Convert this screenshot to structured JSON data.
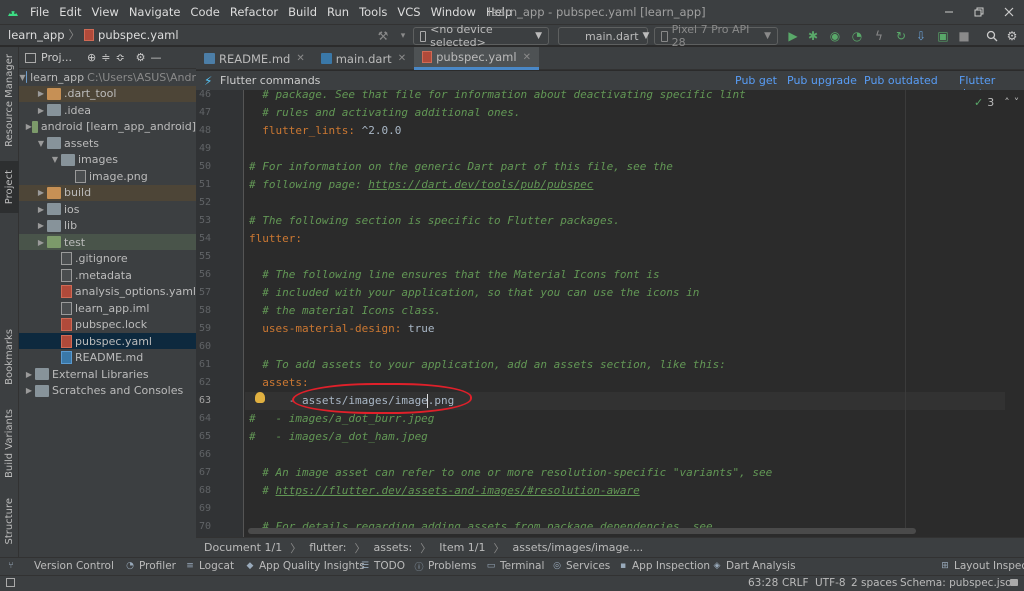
{
  "menu": [
    "File",
    "Edit",
    "View",
    "Navigate",
    "Code",
    "Refactor",
    "Build",
    "Run",
    "Tools",
    "VCS",
    "Window",
    "Help"
  ],
  "window_title": "learn_app - pubspec.yaml [learn_app]",
  "breadcrumb": {
    "project": "learn_app",
    "file": "pubspec.yaml"
  },
  "toolbar": {
    "device_combo": "<no device selected>",
    "run_config": "main.dart",
    "emulator": "Pixel 7 Pro API 28"
  },
  "side_tabs": {
    "resource_manager": "Resource Manager",
    "project": "Project",
    "bookmarks": "Bookmarks",
    "build_variants": "Build Variants",
    "structure": "Structure"
  },
  "project_panel": {
    "title": "Proj...",
    "tree": [
      {
        "label": "learn_app",
        "hint": "C:\\Users\\ASUS\\Andr",
        "kind": "root"
      },
      {
        "label": ".dart_tool",
        "kind": "folder-excluded"
      },
      {
        "label": ".idea",
        "kind": "folder"
      },
      {
        "label": "android [learn_app_android]",
        "kind": "folder"
      },
      {
        "label": "assets",
        "kind": "folder"
      },
      {
        "label": "images",
        "kind": "folder"
      },
      {
        "label": "image.png",
        "kind": "file"
      },
      {
        "label": "build",
        "kind": "folder-excluded"
      },
      {
        "label": "ios",
        "kind": "folder"
      },
      {
        "label": "lib",
        "kind": "folder"
      },
      {
        "label": "test",
        "kind": "folder-test"
      },
      {
        "label": ".gitignore",
        "kind": "file"
      },
      {
        "label": ".metadata",
        "kind": "file"
      },
      {
        "label": "analysis_options.yaml",
        "kind": "yaml"
      },
      {
        "label": "learn_app.iml",
        "kind": "file"
      },
      {
        "label": "pubspec.lock",
        "kind": "yaml"
      },
      {
        "label": "pubspec.yaml",
        "kind": "yaml-selected"
      },
      {
        "label": "README.md",
        "kind": "file"
      },
      {
        "label": "External Libraries",
        "kind": "lib"
      },
      {
        "label": "Scratches and Consoles",
        "kind": "scratch"
      }
    ]
  },
  "editor_tabs": [
    "README.md",
    "main.dart",
    "pubspec.yaml"
  ],
  "flutter_bar": {
    "title": "Flutter commands",
    "pub_get": "Pub get",
    "pub_upgrade": "Pub upgrade",
    "pub_outdated": "Pub outdated",
    "flutter_doctor": "Flutter doctor"
  },
  "inspection_count": "3",
  "code_lines": [
    {
      "n": "46",
      "t": "  # package. See that file for information about deactivating specific lint"
    },
    {
      "n": "47",
      "t": "  # rules and activating additional ones."
    },
    {
      "n": "48",
      "t": "  flutter_lints: ^2.0.0"
    },
    {
      "n": "49",
      "t": ""
    },
    {
      "n": "50",
      "t": "# For information on the generic Dart part of this file, see the"
    },
    {
      "n": "51",
      "t": "# following page: https://dart.dev/tools/pub/pubspec"
    },
    {
      "n": "52",
      "t": ""
    },
    {
      "n": "53",
      "t": "# The following section is specific to Flutter packages."
    },
    {
      "n": "54",
      "t": "flutter:"
    },
    {
      "n": "55",
      "t": ""
    },
    {
      "n": "56",
      "t": "  # The following line ensures that the Material Icons font is"
    },
    {
      "n": "57",
      "t": "  # included with your application, so that you can use the icons in"
    },
    {
      "n": "58",
      "t": "  # the material Icons class."
    },
    {
      "n": "59",
      "t": "  uses-material-design: true"
    },
    {
      "n": "60",
      "t": ""
    },
    {
      "n": "61",
      "t": "  # To add assets to your application, add an assets section, like this:"
    },
    {
      "n": "62",
      "t": "  assets:"
    },
    {
      "n": "63",
      "t": "      - assets/images/image.png"
    },
    {
      "n": "64",
      "t": "#   - images/a_dot_burr.jpeg"
    },
    {
      "n": "65",
      "t": "#   - images/a_dot_ham.jpeg"
    },
    {
      "n": "66",
      "t": ""
    },
    {
      "n": "67",
      "t": "  # An image asset can refer to one or more resolution-specific \"variants\", see"
    },
    {
      "n": "68",
      "t": "  # https://flutter.dev/assets-and-images/#resolution-aware"
    },
    {
      "n": "69",
      "t": ""
    },
    {
      "n": "70",
      "t": "  # For details regarding adding assets from package dependencies, see"
    }
  ],
  "editor_breadcrumb": [
    "Document 1/1",
    "flutter:",
    "assets:",
    "Item 1/1",
    "assets/images/image...."
  ],
  "tool_windows": {
    "version_control": "Version Control",
    "profiler": "Profiler",
    "logcat": "Logcat",
    "app_quality": "App Quality Insights",
    "todo": "TODO",
    "problems": "Problems",
    "terminal": "Terminal",
    "services": "Services",
    "app_inspection": "App Inspection",
    "dart_analysis": "Dart Analysis",
    "layout_inspector": "Layout Inspector"
  },
  "status": {
    "position": "63:28",
    "line_sep": "CRLF",
    "encoding": "UTF-8",
    "indent": "2 spaces",
    "schema": "Schema: pubspec.json"
  },
  "colors": {
    "accent": "#4a88c7",
    "link": "#589df6",
    "comment": "#629755",
    "key": "#cc7832",
    "annotation": "#e0202a"
  }
}
